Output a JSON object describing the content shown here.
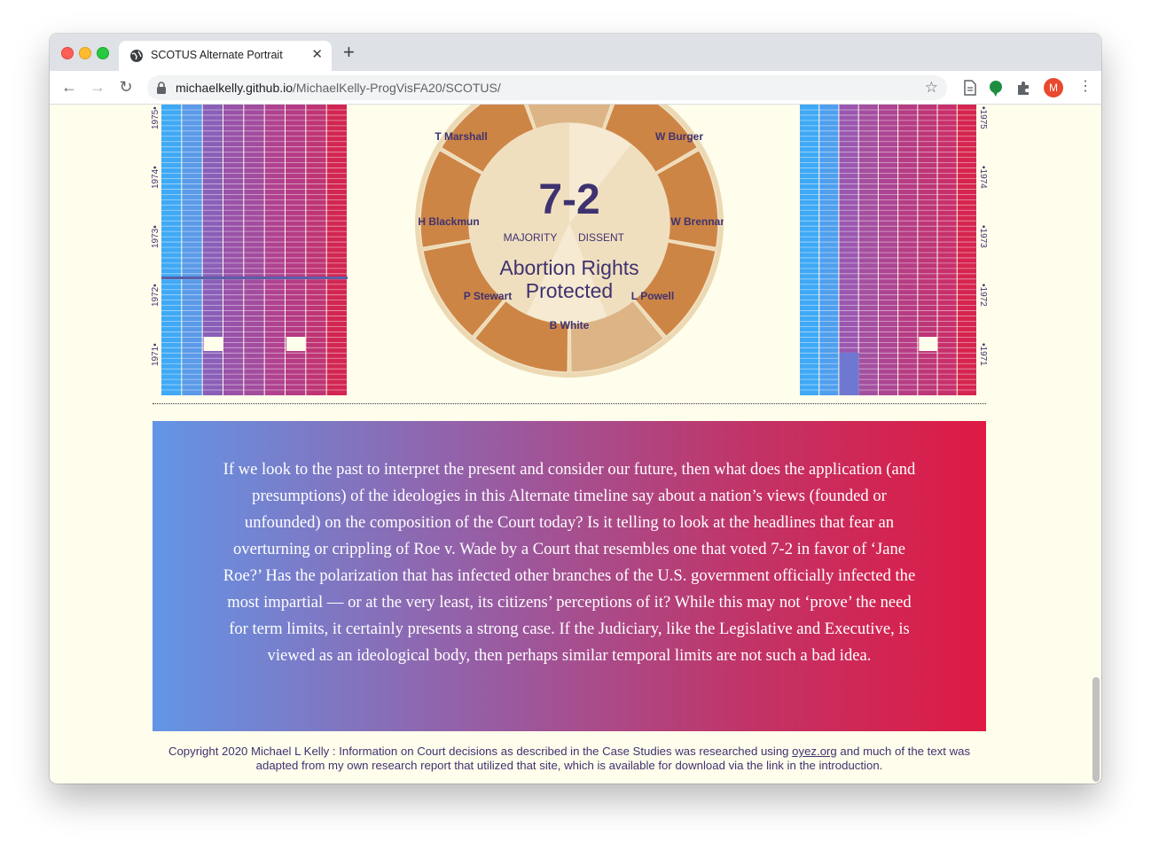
{
  "browser": {
    "tab_title": "SCOTUS Alternate Portrait",
    "url_host": "michaelkelly.github.io",
    "url_path": "/MichaelKelly-ProgVisFA20/SCOTUS/",
    "avatar_letter": "M"
  },
  "grid": {
    "left_years": [
      "1975",
      "1974",
      "1973",
      "1972",
      "1971"
    ],
    "right_years": [
      "1975",
      "1974",
      "1973",
      "1972",
      "1971"
    ]
  },
  "dial": {
    "vote": "7-2",
    "majority_label": "MAJORITY",
    "dissent_label": "DISSENT",
    "outcome_line1": "Abortion Rights",
    "outcome_line2": "Protected",
    "justices": [
      "T Marshall",
      "W Burger",
      "H Blackmun",
      "W Brennan",
      "P Stewart",
      "L Powell",
      "B White"
    ]
  },
  "essay": {
    "text": "If we look to the past to interpret the present and consider our future, then what does the application (and presumptions) of the ideologies in this Alternate timeline say about a nation’s views (founded or unfounded) on the composition of the Court today? Is it telling to look at the headlines that fear an overturning or crippling of Roe v. Wade by a Court that resembles one that voted 7-2 in favor of ‘Jane Roe?’ Has the polarization that has infected other branches of the U.S. government officially infected the most impartial — or at the very least, its citizens’ perceptions of it? While this may not ‘prove’ the need for term limits, it certainly presents a strong case. If the Judiciary, like the Legislative and Executive, is viewed as an ideological body, then perhaps similar temporal limits are not such a bad idea."
  },
  "footer": {
    "text_before": "Copyright 2020 Michael L Kelly : Information on Court decisions as described in the Case Studies was researched using ",
    "link": "oyez.org",
    "text_after": " and much of the text was adapted from my own research report that utilized that site, which is available for download via the link in the introduction."
  },
  "colors": {
    "liberal_blue": "#3fa9f5",
    "conservative_red": "#dc1f45",
    "dial_orange": "#cd8546",
    "dial_center": "#f1e2c4",
    "text_purple": "#3f3270"
  }
}
